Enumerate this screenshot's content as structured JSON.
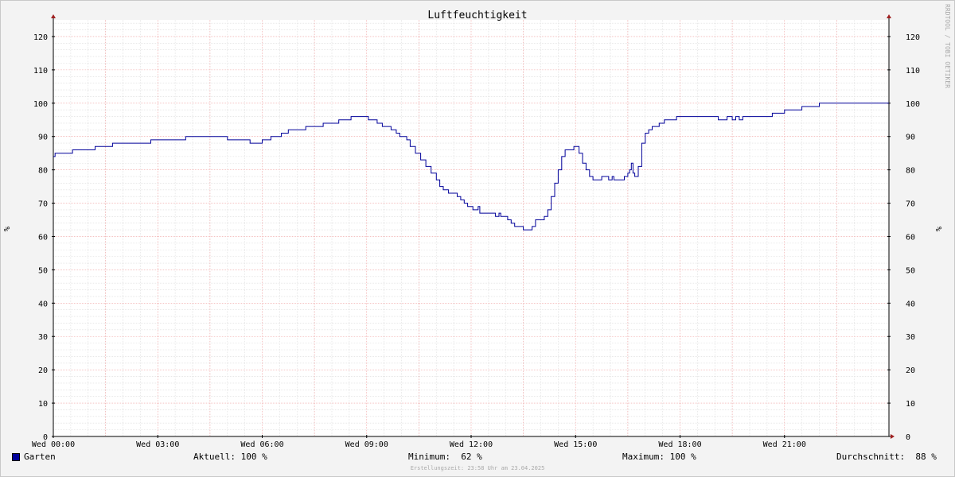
{
  "chart_data": {
    "type": "line",
    "title": "Luftfeuchtigkeit",
    "ylabel": "%",
    "ylabel_right": "%",
    "ylim": [
      0,
      125
    ],
    "xlim_hours": [
      0,
      24
    ],
    "y_ticks": [
      0,
      10,
      20,
      30,
      40,
      50,
      60,
      70,
      80,
      90,
      100,
      110,
      120
    ],
    "x_ticks": [
      {
        "hour": 0,
        "label": "Wed 00:00"
      },
      {
        "hour": 3,
        "label": "Wed 03:00"
      },
      {
        "hour": 6,
        "label": "Wed 06:00"
      },
      {
        "hour": 9,
        "label": "Wed 09:00"
      },
      {
        "hour": 12,
        "label": "Wed 12:00"
      },
      {
        "hour": 15,
        "label": "Wed 15:00"
      },
      {
        "hour": 18,
        "label": "Wed 18:00"
      },
      {
        "hour": 21,
        "label": "Wed 21:00"
      }
    ],
    "grid": true,
    "series": [
      {
        "name": "Garten",
        "color": "#000099",
        "points": [
          [
            0.0,
            84
          ],
          [
            0.05,
            85
          ],
          [
            0.55,
            86
          ],
          [
            1.2,
            87
          ],
          [
            1.7,
            88
          ],
          [
            2.8,
            89
          ],
          [
            3.8,
            90
          ],
          [
            5.0,
            89
          ],
          [
            5.65,
            88
          ],
          [
            6.0,
            89
          ],
          [
            6.25,
            90
          ],
          [
            6.55,
            91
          ],
          [
            6.75,
            92
          ],
          [
            7.25,
            93
          ],
          [
            7.75,
            94
          ],
          [
            8.2,
            95
          ],
          [
            8.55,
            96
          ],
          [
            9.05,
            95
          ],
          [
            9.3,
            94
          ],
          [
            9.45,
            93
          ],
          [
            9.7,
            92
          ],
          [
            9.85,
            91
          ],
          [
            9.95,
            90
          ],
          [
            10.15,
            89
          ],
          [
            10.25,
            87
          ],
          [
            10.4,
            85
          ],
          [
            10.55,
            83
          ],
          [
            10.7,
            81
          ],
          [
            10.85,
            79
          ],
          [
            11.0,
            77
          ],
          [
            11.1,
            75
          ],
          [
            11.2,
            74
          ],
          [
            11.35,
            73
          ],
          [
            11.6,
            72
          ],
          [
            11.7,
            71
          ],
          [
            11.8,
            70
          ],
          [
            11.9,
            69
          ],
          [
            12.05,
            68
          ],
          [
            12.2,
            69
          ],
          [
            12.25,
            67
          ],
          [
            12.5,
            67
          ],
          [
            12.7,
            66
          ],
          [
            12.8,
            67
          ],
          [
            12.85,
            66
          ],
          [
            13.05,
            65
          ],
          [
            13.15,
            64
          ],
          [
            13.25,
            63
          ],
          [
            13.4,
            63
          ],
          [
            13.5,
            62
          ],
          [
            13.65,
            62
          ],
          [
            13.75,
            63
          ],
          [
            13.85,
            65
          ],
          [
            14.0,
            65
          ],
          [
            14.1,
            66
          ],
          [
            14.2,
            68
          ],
          [
            14.3,
            72
          ],
          [
            14.4,
            76
          ],
          [
            14.5,
            80
          ],
          [
            14.6,
            84
          ],
          [
            14.7,
            86
          ],
          [
            14.85,
            86
          ],
          [
            14.95,
            87
          ],
          [
            15.1,
            85
          ],
          [
            15.2,
            82
          ],
          [
            15.3,
            80
          ],
          [
            15.4,
            78
          ],
          [
            15.5,
            77
          ],
          [
            15.65,
            77
          ],
          [
            15.75,
            78
          ],
          [
            15.9,
            78
          ],
          [
            15.95,
            77
          ],
          [
            16.05,
            78
          ],
          [
            16.1,
            77
          ],
          [
            16.3,
            77
          ],
          [
            16.4,
            78
          ],
          [
            16.5,
            79
          ],
          [
            16.55,
            80
          ],
          [
            16.6,
            82
          ],
          [
            16.65,
            79
          ],
          [
            16.7,
            78
          ],
          [
            16.8,
            81
          ],
          [
            16.9,
            88
          ],
          [
            17.0,
            91
          ],
          [
            17.1,
            92
          ],
          [
            17.2,
            93
          ],
          [
            17.4,
            94
          ],
          [
            17.55,
            95
          ],
          [
            17.9,
            96
          ],
          [
            18.0,
            96
          ],
          [
            19.1,
            95
          ],
          [
            19.35,
            96
          ],
          [
            19.5,
            95
          ],
          [
            19.6,
            96
          ],
          [
            19.7,
            95
          ],
          [
            19.8,
            96
          ],
          [
            20.65,
            97
          ],
          [
            21.0,
            98
          ],
          [
            21.5,
            99
          ],
          [
            22.0,
            100
          ],
          [
            24.0,
            100
          ]
        ]
      }
    ]
  },
  "legend": {
    "series_label": "Garten",
    "current_label": "Aktuell: 100 %",
    "minimum_label": "Minimum:  62 %",
    "maximum_label": "Maximum: 100 %",
    "average_label": "Durchschnitt:  88 %"
  },
  "footer": "Erstellungszeit: 23:58 Uhr am 23.04.2025",
  "watermark": "RRDTOOL / TOBI OETIKER"
}
